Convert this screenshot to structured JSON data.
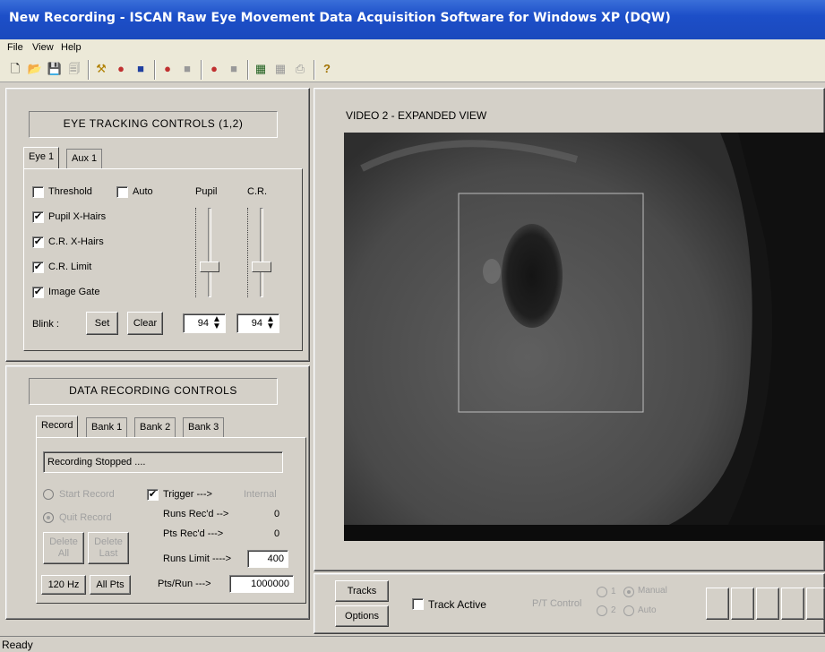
{
  "window": {
    "title": "New Recording - ISCAN Raw Eye Movement Data Acquisition Software for Windows XP (DQW)"
  },
  "menu": [
    "File",
    "View",
    "Help"
  ],
  "toolbar_icons": [
    "new-icon",
    "open-icon",
    "save-icon",
    "copy-icon",
    "tools-icon",
    "record-icon",
    "save-record-icon",
    "record2-icon",
    "save2-icon",
    "record3-icon",
    "save3-icon",
    "chart-icon",
    "chart2-icon",
    "print-icon",
    "help-icon"
  ],
  "eye_tracking": {
    "title": "EYE TRACKING CONTROLS (1,2)",
    "tabs": [
      "Eye 1",
      "Aux 1"
    ],
    "threshold_label": "Threshold",
    "auto_label": "Auto",
    "pupil_label": "Pupil",
    "cr_label": "C.R.",
    "checks": [
      {
        "label": "Pupil X-Hairs",
        "checked": true
      },
      {
        "label": "C.R. X-Hairs",
        "checked": true
      },
      {
        "label": "C.R. Limit",
        "checked": true
      },
      {
        "label": "Image Gate",
        "checked": true
      }
    ],
    "blink_label": "Blink :",
    "set_label": "Set",
    "clear_label": "Clear",
    "pupil_value": "94",
    "cr_value": "94"
  },
  "data_recording": {
    "title": "DATA RECORDING CONTROLS",
    "tabs": [
      "Record",
      "Bank 1",
      "Bank 2",
      "Bank 3"
    ],
    "status": "Recording Stopped ....",
    "start_record": "Start Record",
    "quit_record": "Quit Record",
    "trigger_label": "Trigger --->",
    "internal_label": "Internal",
    "runs_recd_label": "Runs Rec'd -->",
    "runs_recd_value": "0",
    "pts_recd_label": "Pts Rec'd --->",
    "pts_recd_value": "0",
    "delete_all_1": "Delete",
    "delete_all_2": "All",
    "delete_last_1": "Delete",
    "delete_last_2": "Last",
    "runs_limit_label": "Runs Limit ---->",
    "runs_limit_value": "400",
    "hz_label": "120 Hz",
    "allpts_label": "All Pts",
    "pts_run_label": "Pts/Run --->",
    "pts_run_value": "1000000"
  },
  "video": {
    "title": "VIDEO 2 - EXPANDED VIEW"
  },
  "bottom": {
    "tracks": "Tracks",
    "options": "Options",
    "track_active": "Track Active",
    "pt_control": "P/T Control",
    "radio1": "1",
    "radio2": "2",
    "manual": "Manual",
    "auto": "Auto"
  },
  "status_bar": "Ready"
}
